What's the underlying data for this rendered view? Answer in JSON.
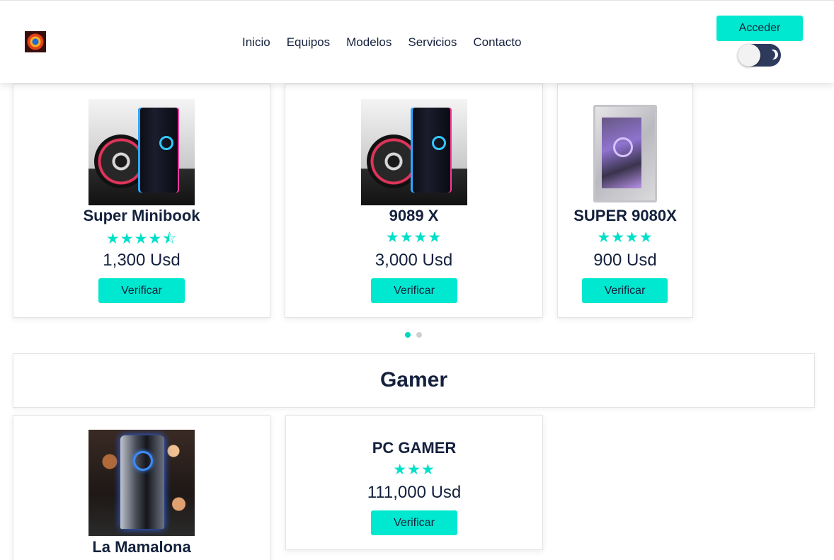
{
  "header": {
    "logo_icon": "game-controller-logo-icon",
    "nav": [
      "Inicio",
      "Equipos",
      "Modelos",
      "Servicios",
      "Contacto"
    ],
    "login_label": "Acceder",
    "theme_toggle_icon": "moon-icon",
    "theme_toggle_state": "light"
  },
  "colors": {
    "accent": "#00e8cf",
    "text": "#14213d",
    "star": "#00e0c8"
  },
  "carousel": {
    "products": [
      {
        "name": "Super Minibook",
        "rating": 4.5,
        "stars": "★★★★⯪",
        "price": "1,300 Usd",
        "button": "Verificar",
        "image": "dark-gaming-pc-with-fan"
      },
      {
        "name": "9089 X",
        "rating": 4,
        "stars": "★★★★",
        "price": "3,000 Usd",
        "button": "Verificar",
        "image": "dark-gaming-pc-with-fan"
      },
      {
        "name": "SUPER 9080X",
        "rating": 4,
        "stars": "★★★★",
        "price": "900 Usd",
        "button": "Verificar",
        "image": "silver-rog-pc-case"
      }
    ],
    "page_count": 2,
    "active_page": 1
  },
  "gamer": {
    "title": "Gamer",
    "products": [
      {
        "name": "La Mamalona",
        "image": "gamer-pc-blue-lights"
      },
      {
        "name": "PC GAMER",
        "rating": 3,
        "stars": "★★★",
        "price": "111,000 Usd",
        "button": "Verificar"
      }
    ]
  }
}
